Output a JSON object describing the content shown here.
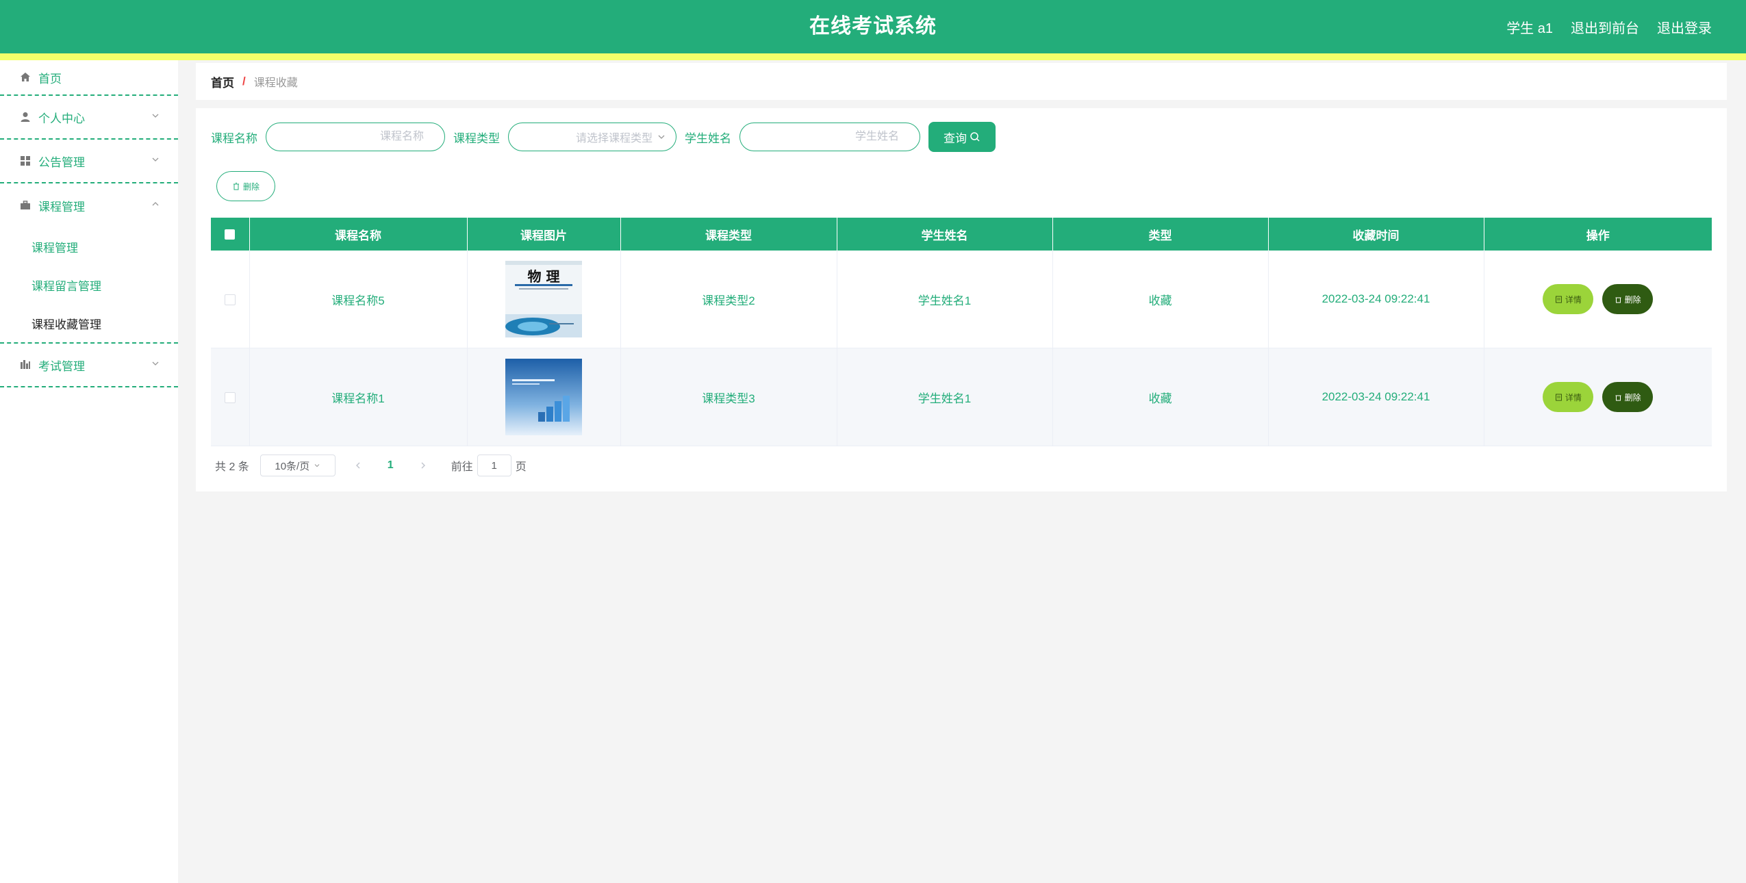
{
  "header": {
    "title": "在线考试系统",
    "user": "学生 a1",
    "back_to_front": "退出到前台",
    "logout": "退出登录"
  },
  "sidebar": {
    "items": [
      {
        "label": "首页",
        "icon": "home-icon"
      },
      {
        "label": "个人中心",
        "icon": "user-icon"
      },
      {
        "label": "公告管理",
        "icon": "grid-icon"
      },
      {
        "label": "课程管理",
        "icon": "briefcase-icon",
        "children": [
          "课程管理",
          "课程留言管理",
          "课程收藏管理"
        ]
      },
      {
        "label": "考试管理",
        "icon": "chart-icon"
      }
    ]
  },
  "breadcrumb": {
    "home": "首页",
    "separator": "/",
    "current": "课程收藏"
  },
  "search": {
    "course_name_label": "课程名称",
    "course_name_placeholder": "课程名称",
    "course_type_label": "课程类型",
    "course_type_placeholder": "请选择课程类型",
    "student_name_label": "学生姓名",
    "student_name_placeholder": "学生姓名",
    "query_button": "查询"
  },
  "toolbar": {
    "delete_label": "删除"
  },
  "table": {
    "headers": [
      "课程名称",
      "课程图片",
      "课程类型",
      "学生姓名",
      "类型",
      "收藏时间",
      "操作"
    ],
    "rows": [
      {
        "name": "课程名称5",
        "image": "物理 textbook cover",
        "type": "课程类型2",
        "student": "学生姓名1",
        "kind": "收藏",
        "time": "2022-03-24 09:22:41"
      },
      {
        "name": "课程名称1",
        "image": "计算机网络 book cover",
        "type": "课程类型3",
        "student": "学生姓名1",
        "kind": "收藏",
        "time": "2022-03-24 09:22:41"
      }
    ],
    "detail_label": "详情",
    "delete_label": "删除"
  },
  "pagination": {
    "total": "共 2 条",
    "page_size": "10条/页",
    "current_page": "1",
    "goto_label": "前往",
    "goto_value": "1",
    "page_suffix": "页"
  },
  "colors": {
    "primary": "#23ad7a",
    "stripe": "#f3ff6a",
    "detail": "#9bd43a",
    "delete": "#2f5b12"
  }
}
